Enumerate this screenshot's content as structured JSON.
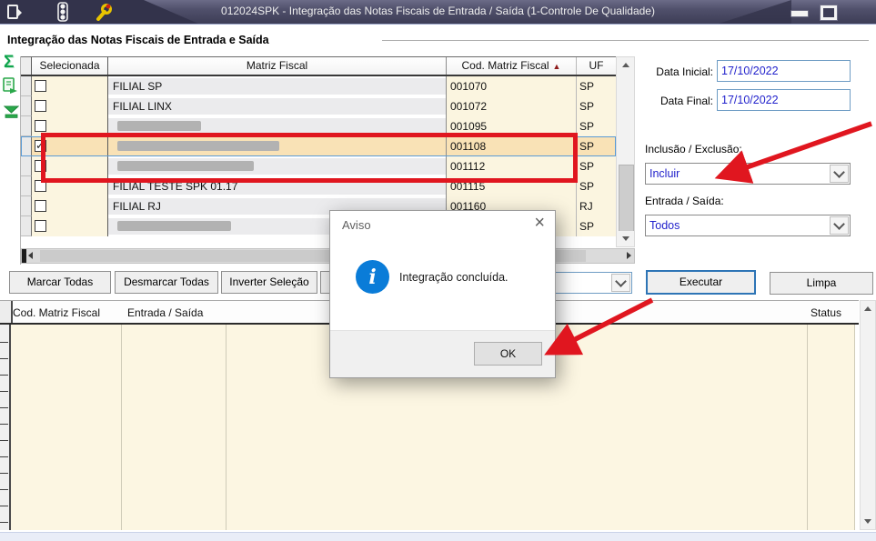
{
  "window": {
    "title": "012024SPK - Integração das Notas Fiscais de Entrada / Saída (1-Controle De Qualidade)"
  },
  "group": {
    "title": "Integração das Notas Fiscais de Entrada e Saída"
  },
  "grid1": {
    "columns": {
      "selecionada": "Selecionada",
      "matriz": "Matriz Fiscal",
      "cod": "Cod. Matriz Fiscal",
      "uf": "UF",
      "sort_icon": "▲"
    },
    "rows": [
      {
        "matriz": "FILIAL SP",
        "cod": "001070",
        "uf": "SP",
        "checked": false,
        "selected": false,
        "masked": false,
        "mask_w": 0
      },
      {
        "matriz": "FILIAL LINX",
        "cod": "001072",
        "uf": "SP",
        "checked": false,
        "selected": false,
        "masked": false,
        "mask_w": 0
      },
      {
        "matriz": "",
        "cod": "001095",
        "uf": "SP",
        "checked": false,
        "selected": false,
        "masked": true,
        "mask_w": 92
      },
      {
        "matriz": "",
        "cod": "001108",
        "uf": "SP",
        "checked": true,
        "selected": true,
        "masked": true,
        "mask_w": 178
      },
      {
        "matriz": "",
        "cod": "001112",
        "uf": "SP",
        "checked": false,
        "selected": false,
        "masked": true,
        "mask_w": 150
      },
      {
        "matriz": "FILIAL TESTE SPK 01.17",
        "cod": "001115",
        "uf": "SP",
        "checked": false,
        "selected": false,
        "masked": false,
        "mask_w": 0
      },
      {
        "matriz": "FILIAL RJ",
        "cod": "001160",
        "uf": "RJ",
        "checked": false,
        "selected": false,
        "masked": false,
        "mask_w": 0
      },
      {
        "matriz": "",
        "cod": "",
        "uf": "SP",
        "checked": false,
        "selected": false,
        "masked": true,
        "mask_w": 125
      }
    ]
  },
  "filters": {
    "data_inicial_label": "Data Inicial:",
    "data_inicial_value": "17/10/2022",
    "data_final_label": "Data Final:",
    "data_final_value": "17/10/2022",
    "inclusao_label": "Inclusão / Exclusão:",
    "inclusao_value": "Incluir",
    "entrada_label": "Entrada / Saída:",
    "entrada_value": "Todos"
  },
  "buttons": {
    "marcar": "Marcar Todas",
    "desmarcar": "Desmarcar Todas",
    "inverter": "Inverter Seleção",
    "executar": "Executar",
    "limpa": "Limpa"
  },
  "dialog": {
    "title": "Aviso",
    "message": "Integração concluída.",
    "ok": "OK",
    "close_icon": "×",
    "info_icon": "i"
  },
  "grid2": {
    "columns": [
      "Cod. Matriz Fiscal",
      "Entrada / Saída",
      "Status"
    ]
  },
  "colors": {
    "annotation_red": "#E0161F",
    "selection_orange": "#F9E2B6",
    "value_blue": "#2222CC",
    "info_blue": "#0A7CD8",
    "titlebar_dark": "#3D3D56"
  }
}
